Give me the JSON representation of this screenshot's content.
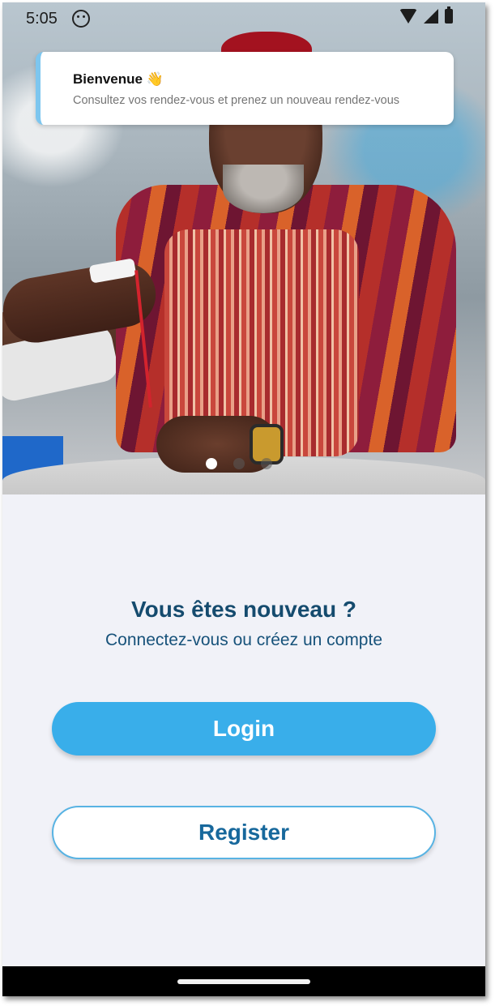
{
  "status_bar": {
    "time": "5:05",
    "icons": [
      "face-notification-icon",
      "wifi-icon",
      "signal-icon",
      "battery-icon"
    ]
  },
  "toast": {
    "title": "Bienvenue 👋",
    "message": "Consultez vos rendez-vous et prenez un nouveau rendez-vous",
    "accent_color": "#7dc6ef"
  },
  "carousel": {
    "slide_count": 3,
    "active_index": 0
  },
  "welcome": {
    "heading": "Vous êtes nouveau ?",
    "subheading": "Connectez-vous ou créez un compte"
  },
  "actions": {
    "login_label": "Login",
    "register_label": "Register"
  },
  "colors": {
    "primary": "#39aeea",
    "heading": "#154b6e",
    "background": "#f1f2f8"
  }
}
